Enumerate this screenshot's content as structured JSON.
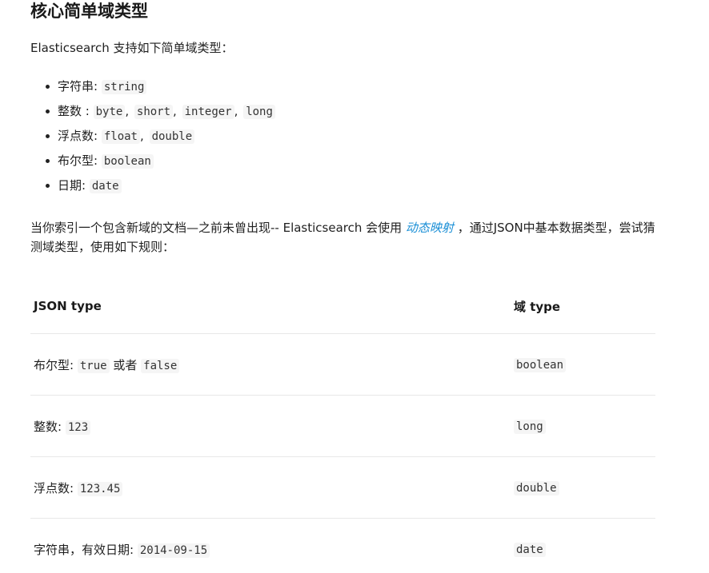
{
  "heading": "核心简单域类型",
  "intro": "Elasticsearch 支持如下简单域类型：",
  "types": [
    {
      "label": "字符串:",
      "codes": [
        "string"
      ]
    },
    {
      "label": "整数 :",
      "codes": [
        "byte",
        "short",
        "integer",
        "long"
      ]
    },
    {
      "label": "浮点数:",
      "codes": [
        "float",
        "double"
      ]
    },
    {
      "label": "布尔型:",
      "codes": [
        "boolean"
      ]
    },
    {
      "label": "日期:",
      "codes": [
        "date"
      ]
    }
  ],
  "paragraph": {
    "before": "当你索引一个包含新域的文档—之前未曾出现-- Elasticsearch 会使用 ",
    "link": "动态映射",
    "after": " ，通过JSON中基本数据类型，尝试猜测域类型，使用如下规则："
  },
  "table": {
    "headers": [
      "JSON type",
      "域 type"
    ],
    "rows": [
      {
        "label": "布尔型:",
        "code1": "true",
        "mid": "或者",
        "code2": "false",
        "type": "boolean"
      },
      {
        "label": "整数:",
        "code1": "123",
        "type": "long"
      },
      {
        "label": "浮点数:",
        "code1": "123.45",
        "type": "double"
      },
      {
        "label": "字符串，有效日期:",
        "code1": "2014-09-15",
        "type": "date"
      }
    ]
  }
}
